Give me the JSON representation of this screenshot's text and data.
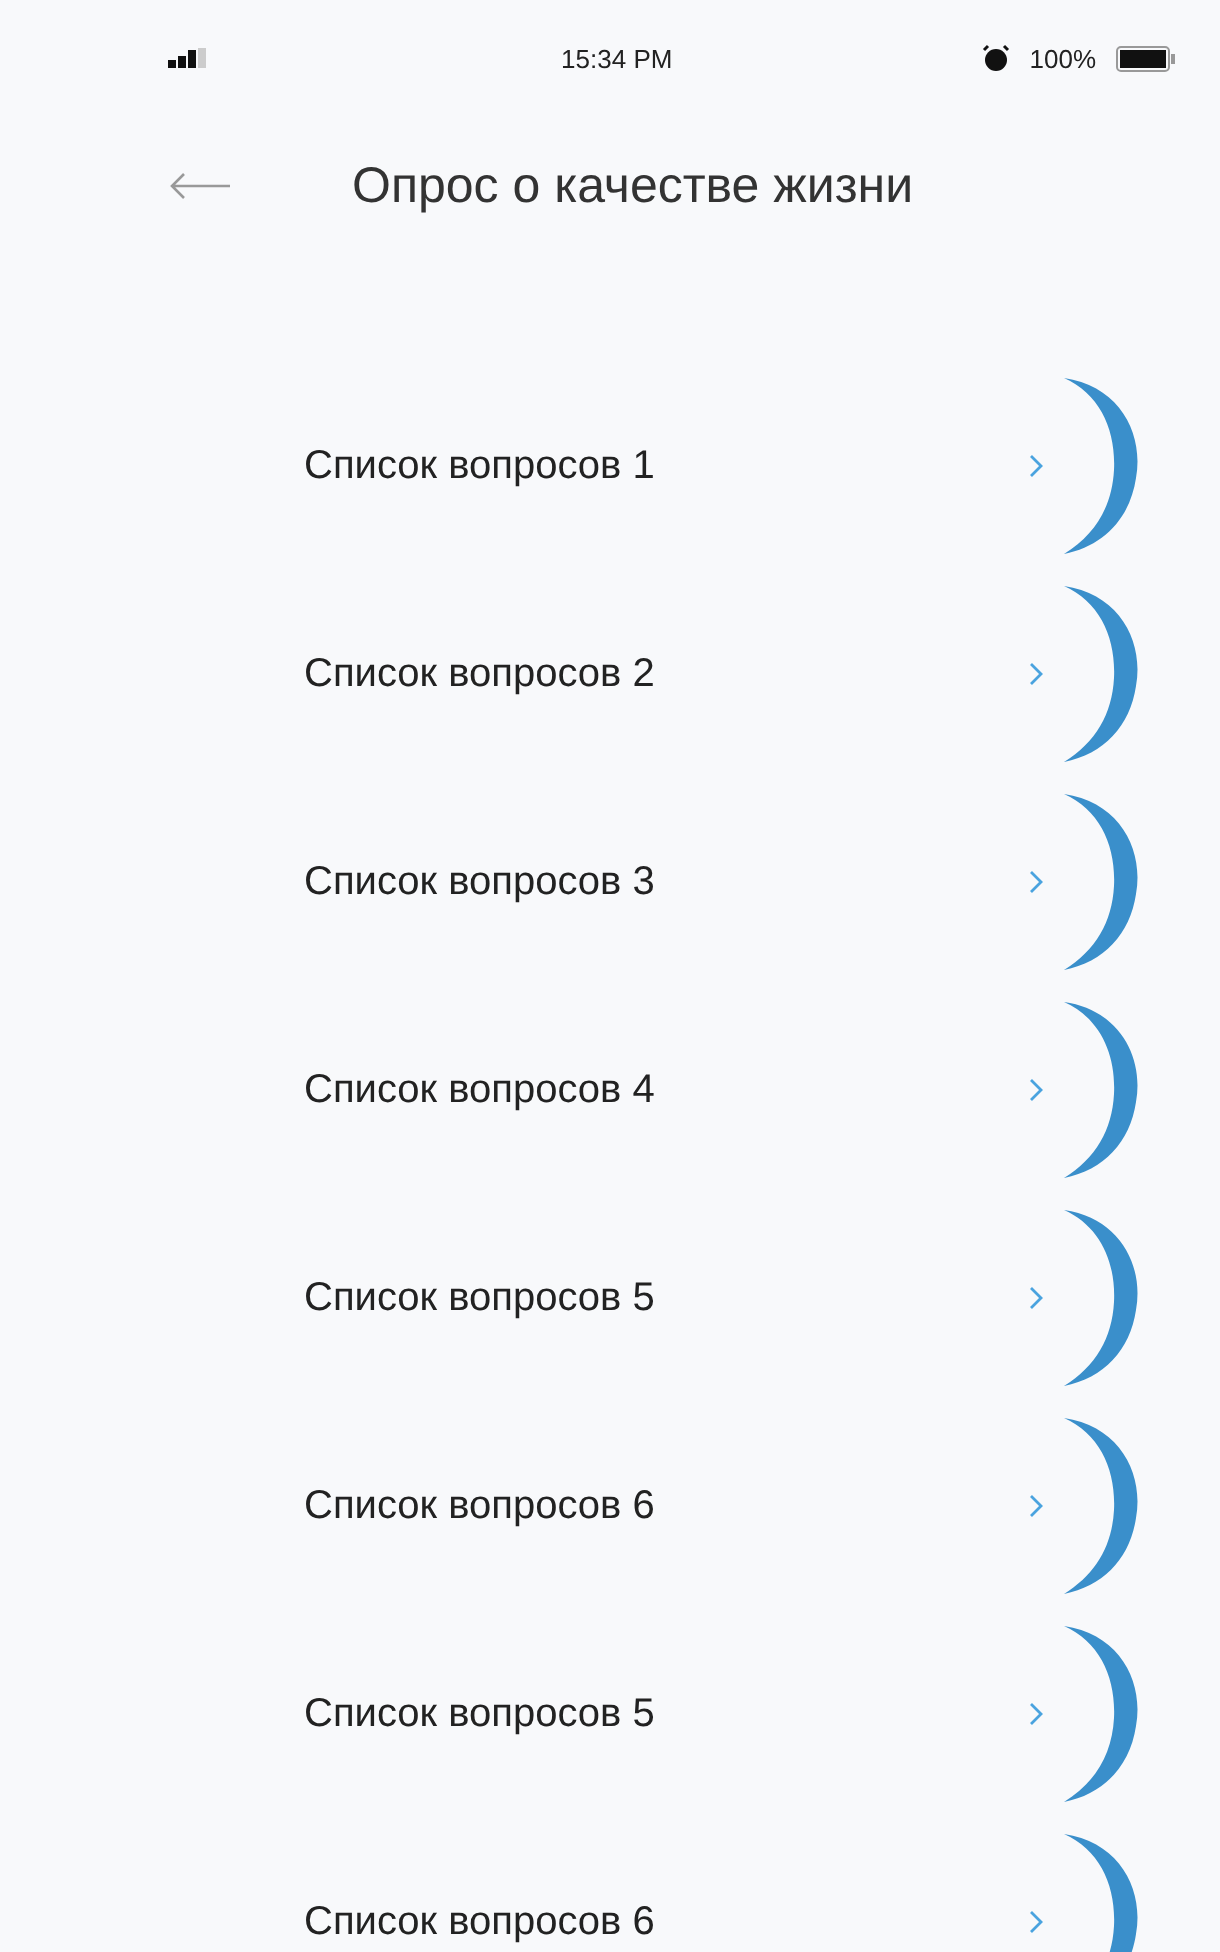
{
  "status_bar": {
    "time": "15:34 PM",
    "battery": "100%"
  },
  "header": {
    "title": "Опрос о качестве жизни"
  },
  "items": [
    {
      "label": "Список вопросов 1"
    },
    {
      "label": "Список вопросов 2"
    },
    {
      "label": "Список вопросов 3"
    },
    {
      "label": "Список вопросов 4"
    },
    {
      "label": "Список вопросов 5"
    },
    {
      "label": "Список вопросов 6"
    },
    {
      "label": "Список вопросов 5"
    },
    {
      "label": "Список вопросов 6"
    }
  ]
}
